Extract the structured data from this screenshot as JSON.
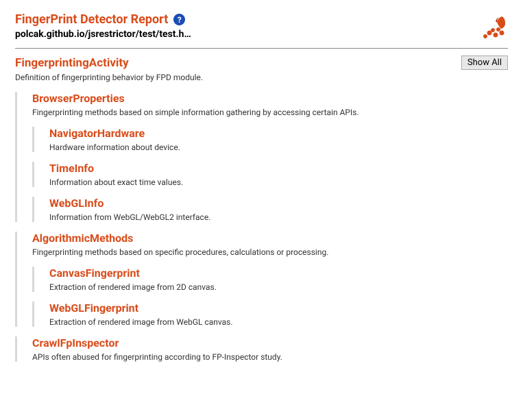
{
  "header": {
    "title": "FingerPrint Detector Report",
    "help_icon": "?",
    "url": "polcak.github.io/jsrestrictor/test/test.h…"
  },
  "section": {
    "title": "FingerprintingActivity",
    "show_all_label": "Show All",
    "description": "Definition of fingerprinting behavior by FPD module."
  },
  "groups": [
    {
      "title": "BrowserProperties",
      "description": "Fingerprinting methods based on simple information gathering by accessing certain APIs.",
      "subgroups": [
        {
          "title": "NavigatorHardware",
          "description": "Hardware information about device."
        },
        {
          "title": "TimeInfo",
          "description": "Information about exact time values."
        },
        {
          "title": "WebGLInfo",
          "description": "Information from WebGL/WebGL2 interface."
        }
      ]
    },
    {
      "title": "AlgorithmicMethods",
      "description": "Fingerprinting methods based on specific procedures, calculations or processing.",
      "subgroups": [
        {
          "title": "CanvasFingerprint",
          "description": "Extraction of rendered image from 2D canvas."
        },
        {
          "title": "WebGLFingerprint",
          "description": "Extraction of rendered image from WebGL canvas."
        }
      ]
    },
    {
      "title": "CrawlFpInspector",
      "description": "APIs often abused for fingerprinting according to FP-Inspector study.",
      "subgroups": []
    }
  ]
}
